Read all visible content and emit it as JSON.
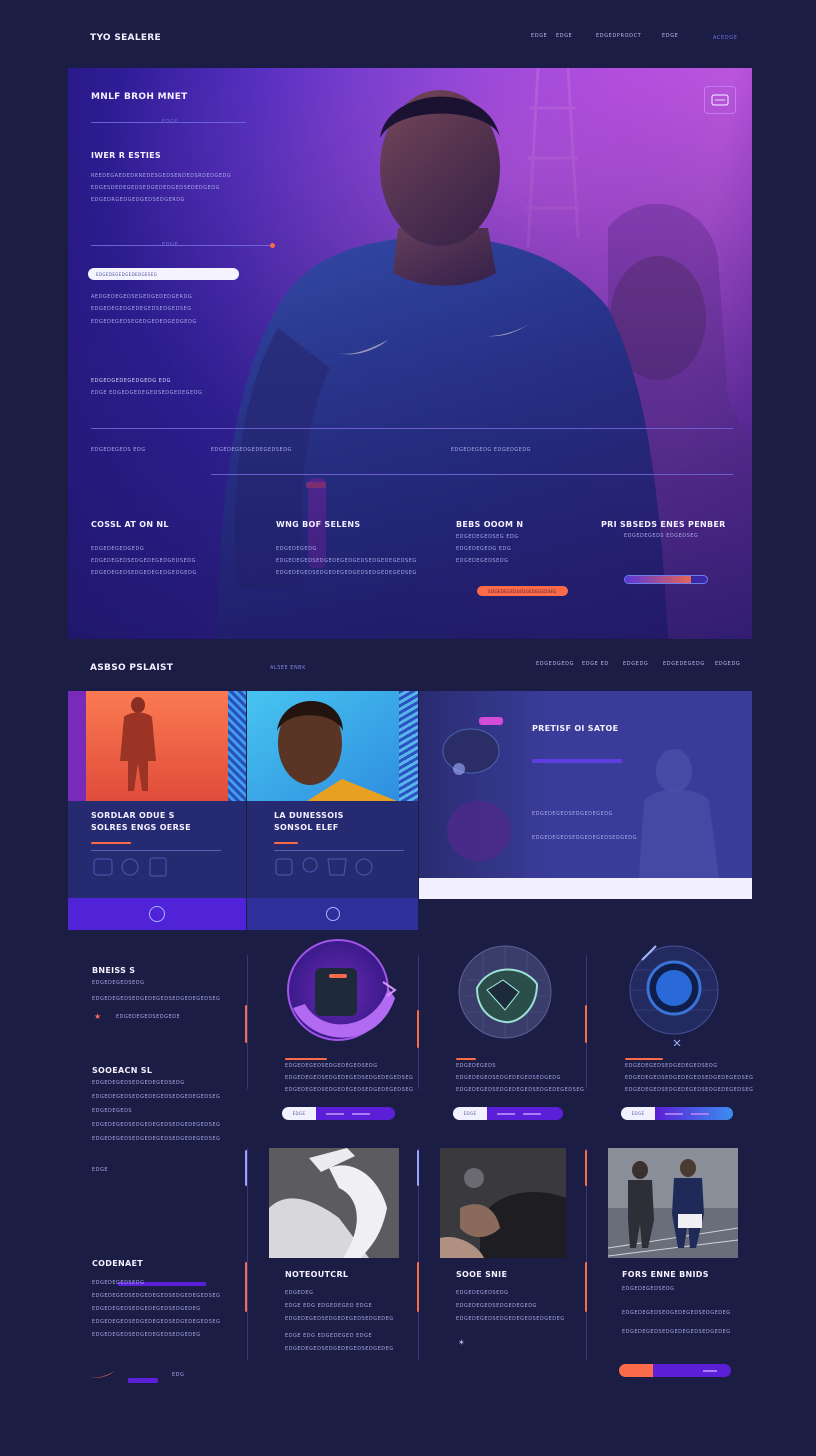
{
  "header": {
    "logo": "TYO SEALERE",
    "nav": [
      "EDGE",
      "EDGE",
      "EDGEDPRODCT",
      "EDGE",
      "ACEDGE"
    ]
  },
  "hero": {
    "title": "MNLF BROH MNET",
    "center_label": "EDGE",
    "subtitle": "IWER R ESTIES",
    "desc_lines": [
      "REEDEGAEDEDRNEDESGEDSENDEDSRDEDGEDG",
      "EDGESDEDEGEDSEDGEDEDGEDSEDEDGEDG",
      "EDGEDRGEDGEDGEDSEDGERDG"
    ],
    "slider_label": "EDGE",
    "search_placeholder": "EDGEDEGEDGEDEDGESEG",
    "info_lines": [
      "AEDGEDEGEDSEGEDGEDEDGERDG",
      "EDGEDEGEDGEDEGEDSEDGEDSEG",
      "EDGEDEGEDSEGEDGEDEDGEDGEDG"
    ],
    "small_head": "EDGEDGEDEGEDGEDG EDG",
    "small_line": "EDGE EDGEDGEDEGEDSEDGEDEGEDG",
    "divider_labels": [
      "EDGEDEGEDS EDG",
      "EDGEDEGEDGEDEGEDSEDG",
      "EDGEDEGEDG EDGEDGEDG"
    ],
    "badge_icon": "brand-badge-icon",
    "columns": [
      {
        "title": "COSSL AT ON NL",
        "lines": [
          "EDGEDEGEDGEDG",
          "EDGEDEGEDSEDGEDEGEDGEDSEDG",
          "EDGEDEGEDSEDGEDEGEDGEDGEDG"
        ]
      },
      {
        "title": "WNG BOF SELENS",
        "lines": [
          "EDGEDEGEDG",
          "EDGEDEGEDSEDGEDEGEDGEDSEDGEDEGEDSEG",
          "EDGEDEGEDSEDGEDEGEDGEDSEDGEDEGEDSEG"
        ]
      },
      {
        "title": "BEBS OOOM N",
        "lines": [
          "EDGEDEGEDSEG EDG",
          "EDGEDEGEDG EDG",
          "EDGEDEGEDSEDG"
        ]
      },
      {
        "title": "PRI SBSEDS ENES PENBER",
        "lines": [
          "EDGEDEGEDS EDGEDSEG"
        ]
      }
    ],
    "cta_label": "EDGEDEGEDSEDGEDEGEDSEG"
  },
  "section2": {
    "title": "ASBSO PSLAIST",
    "sublabel": "ALSEE ENBK",
    "nav": [
      "EDGEDGEDG",
      "EDGE ED",
      "EDGEDG",
      "EDGEDEGEDG",
      "EDGEDG"
    ],
    "card_a": {
      "title1": "SORDLAR ODUE S",
      "title2": "SOLRES ENGS OERSE",
      "icon": "tool-icons"
    },
    "card_b": {
      "title1": "LA DUNESSOIS",
      "title2": "SONSOL ELEF",
      "icon": "tool-icons"
    },
    "feature": {
      "title": "PRETISF OI SATOE",
      "lines": [
        "EDGEDEGEDSEDGEDEGEDG",
        "EDGEDEGEDSEDGEDEGEDSEDGEDG"
      ]
    }
  },
  "products": {
    "left": {
      "title": "BNEISS S",
      "lines": [
        "EDGEDEGEDSEDG",
        "EDGEDEGEDSEDGEDEGEDSEDGEDEGEDSEG"
      ],
      "star_line": "EDGEDEGEDSEDGEDE",
      "title2": "SOOEACN SL",
      "lines2": [
        "EDGEDEGEDSEDGEDEGEDSEDG",
        "EDGEDEGEDSEDGEDEGEDSEDGEDEGEDSEG",
        "EDGEDEGEDS",
        "EDGEDEGEDSEDGEDEGEDSEDGEDEGEDSEG",
        "EDGEDEGEDSEDGEDEGEDSEDGEDEGEDSEG"
      ],
      "small": "EDGE"
    },
    "items": [
      {
        "lines": [
          "EDGEDEGEDSEDGEDEGEDSEDG",
          "EDGEDEGEDSEDGEDEGEDSEDGEDEGEDSEG",
          "EDGEDEGEDSEDGEDEGEDSEDGEDEGEDSEG"
        ],
        "btn": "EDGE"
      },
      {
        "lines": [
          "EDGEDEGEDS",
          "EDGEDEGEDSEDGEDEGEDSEDGEDG",
          "EDGEDEGEDSEDGEDEGEDSEDGEDEGEDSEG"
        ],
        "btn": "EDGE"
      },
      {
        "lines": [
          "EDGEDEGEDSEDGEDEGEDSEDG",
          "EDGEDEGEDSEDGEDEGEDSEDGEDEGEDSEG",
          "EDGEDEGEDSEDGEDEGEDSEDGEDEGEDSEG"
        ],
        "btn": "EDGE"
      }
    ]
  },
  "bottom": {
    "left": {
      "title": "CODENAET",
      "lines": [
        "EDGEDEGEDSEDG",
        "EDGEDEGEDSEDGEDEGEDSEDGEDEGEDSEG",
        "EDGEDEGEDSEDGEDEGEDSEDGEDEG",
        "EDGEDEGEDSEDGEDEGEDSEDGEDEGEDSEG",
        "EDGEDEGEDSEDGEDEGEDSEDGEDEG"
      ],
      "small": "EDG"
    },
    "items": [
      {
        "title": "NOTEOUTCRL",
        "lines": [
          "EDGEDEG",
          "EDGE EDG EDGEDEGED EDGE",
          "EDGEDEGEDSEDGEDEGEDSEDGEDEG",
          "EDGE EDG EDGEDEGED EDGE",
          "EDGEDEGEDSEDGEDEGEDSEDGEDEG"
        ]
      },
      {
        "title": "SOOE SNIE",
        "lines": [
          "EDGEDEGEDSEDG",
          "EDGEDEGEDSEDGEDEGEDG",
          "EDGEDEGEDSEDGEDEGEDSEDGEDEG"
        ]
      },
      {
        "title": "FORS ENNE BNIDS",
        "lines": [
          "EDGEDEGEDSEDG",
          "EDGEDEGEDSEDGEDEGEDSEDGEDEG",
          "EDGEDEGEDSEDGEDEGEDSEDGEDEG"
        ]
      }
    ]
  },
  "colors": {
    "accent": "#fb6b4a",
    "purple": "#5a1fd6",
    "bg": "#1b1d45"
  }
}
